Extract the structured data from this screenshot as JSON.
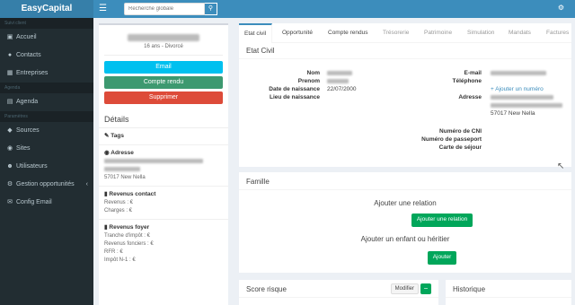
{
  "brand": "EasyCapital",
  "search": {
    "placeholder": "Recherche globale"
  },
  "icons": {
    "menu": "hamburger-icon",
    "search": "search-icon",
    "settings": "gear-icon"
  },
  "sidebar": {
    "section1": "Suivi client",
    "items1": [
      {
        "label": "Accueil",
        "icon": "dashboard-icon"
      },
      {
        "label": "Contacts",
        "icon": "users-icon"
      },
      {
        "label": "Entreprises",
        "icon": "building-icon"
      }
    ],
    "section2": "Agenda",
    "items2": [
      {
        "label": "Agenda",
        "icon": "calendar-icon"
      }
    ],
    "section3": "Paramètres",
    "items3": [
      {
        "label": "Sources",
        "icon": "source-icon"
      },
      {
        "label": "Sites",
        "icon": "map-marker-icon"
      },
      {
        "label": "Utilisateurs",
        "icon": "user-icon"
      },
      {
        "label": "Gestion opportunités",
        "icon": "cog-icon"
      },
      {
        "label": "Config Email",
        "icon": "envelope-icon"
      }
    ]
  },
  "profile": {
    "subtitle": "16 ans - Divorcé",
    "buttons": {
      "email": "Email",
      "compte_rendu": "Compte rendu",
      "supprimer": "Supprimer"
    },
    "details_title": "Détails",
    "tags": "Tags",
    "adresse_title": "Adresse",
    "adresse_city": "57017 New Nella",
    "revenus_contact_title": "Revenus contact",
    "revenus": "Revenus : €",
    "charges": "Charges : €",
    "revenus_foyer_title": "Revenus foyer",
    "tranche": "Tranche d'impôt : €",
    "fonciers": "Revenus fonciers : €",
    "rfr": "RFR : €",
    "impot": "Impôt N-1 : €"
  },
  "tabs": [
    {
      "label": "Etat civil",
      "active": true
    },
    {
      "label": "Opportunité"
    },
    {
      "label": "Compte rendus"
    },
    {
      "label": "Trésorerie",
      "disabled": true
    },
    {
      "label": "Patrimoine",
      "disabled": true
    },
    {
      "label": "Simulation",
      "disabled": true
    },
    {
      "label": "Mandats",
      "disabled": true
    },
    {
      "label": "Factures",
      "disabled": true
    }
  ],
  "etat_civil": {
    "title": "Etat Civil",
    "labels": {
      "nom": "Nom",
      "prenom": "Prenom",
      "date_naissance": "Date de naissance",
      "lieu_naissance": "Lieu de naissance",
      "email": "E-mail",
      "telephone": "Téléphone",
      "adresse": "Adresse",
      "cni": "Numéro de CNI",
      "passeport": "Numéro de passeport",
      "sejour": "Carte de séjour"
    },
    "date_naissance": "22/07/2000",
    "add_phone": "+ Ajouter un numéro",
    "adresse_city": "57017 New Nella"
  },
  "famille": {
    "title": "Famille",
    "relation_text": "Ajouter une relation",
    "relation_btn": "Ajouter une relation",
    "enfant_text": "Ajouter un enfant ou héritier",
    "enfant_btn": "Ajouter"
  },
  "score": {
    "title": "Score risque",
    "modifier": "Modifier",
    "minus": "−"
  },
  "historique": {
    "title": "Historique"
  }
}
